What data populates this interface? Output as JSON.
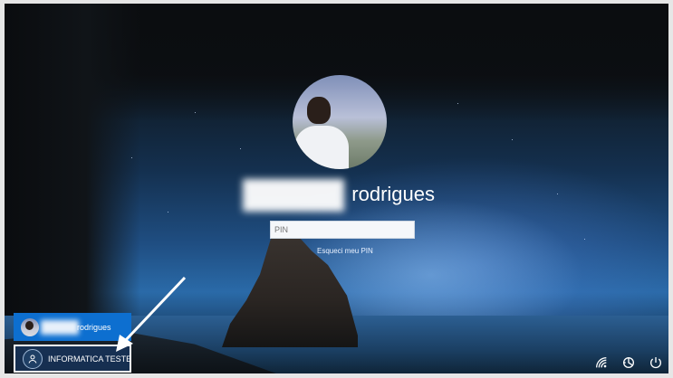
{
  "login": {
    "username_suffix": "rodrigues",
    "pin_placeholder": "PIN",
    "forgot_pin_label": "Esqueci meu PIN"
  },
  "users": [
    {
      "name_suffix": "rodrigues",
      "state": "active"
    },
    {
      "name": "INFORMATICA TESTE",
      "state": "selected"
    }
  ],
  "tray": {
    "icons": [
      "network-icon",
      "ease-of-access-icon",
      "power-icon"
    ]
  },
  "colors": {
    "accent": "#0d6fd0",
    "text": "#ffffff"
  }
}
